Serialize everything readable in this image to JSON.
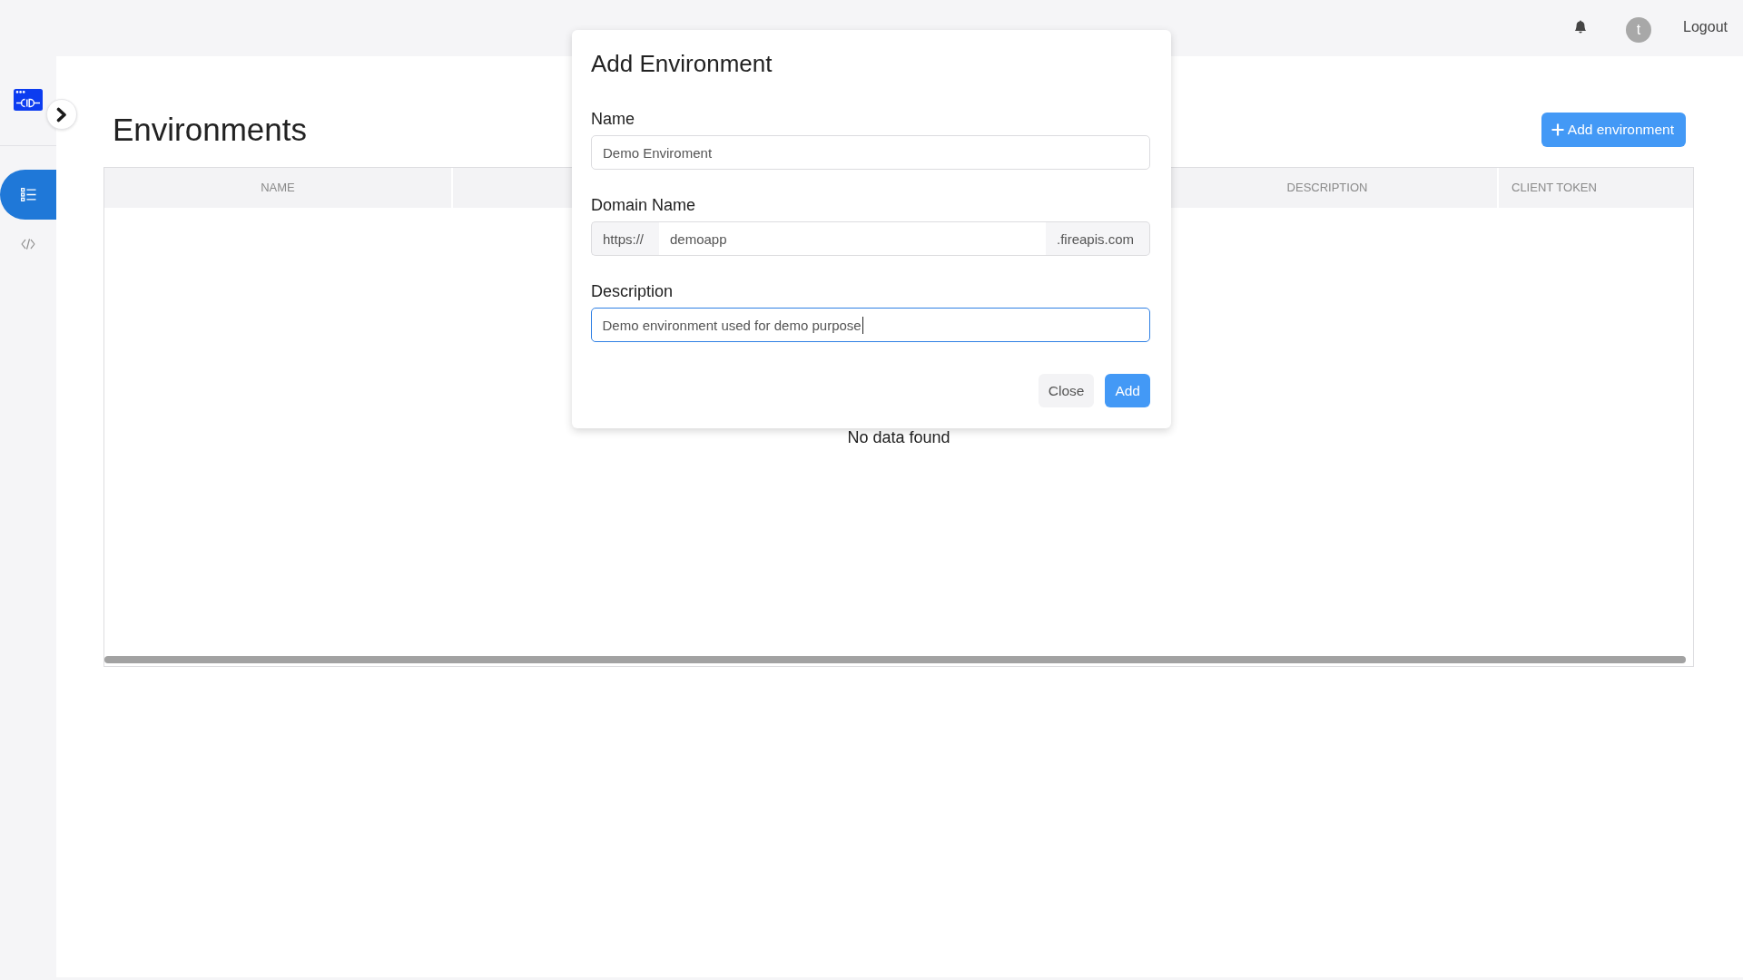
{
  "sidebar": {
    "expanded": false,
    "items": [
      {
        "kind": "list",
        "selected": true
      },
      {
        "kind": "code",
        "selected": false
      }
    ]
  },
  "topbar": {
    "avatar_initial": "t",
    "logout": "Logout"
  },
  "page": {
    "title": "Environments",
    "add_button": "Add environment"
  },
  "table": {
    "columns": [
      "NAME",
      "DESCRIPTION",
      "CLIENT TOKEN"
    ],
    "empty_message": "No data found"
  },
  "dialog": {
    "title": "Add Environment",
    "fields": [
      {
        "kind": "text",
        "label": "Name",
        "value": "Demo Enviroment",
        "focused": false
      },
      {
        "kind": "url",
        "label": "Domain Name",
        "prefix": "https://",
        "value": "demoapp",
        "suffix": ".fireapis.com",
        "focused": false
      },
      {
        "kind": "text",
        "label": "Description",
        "value": "Demo environment used for demo purpose",
        "focused": true
      }
    ],
    "buttons": [
      {
        "kind": "secondary",
        "label": "Close"
      },
      {
        "kind": "primary",
        "label": "Add"
      }
    ]
  }
}
